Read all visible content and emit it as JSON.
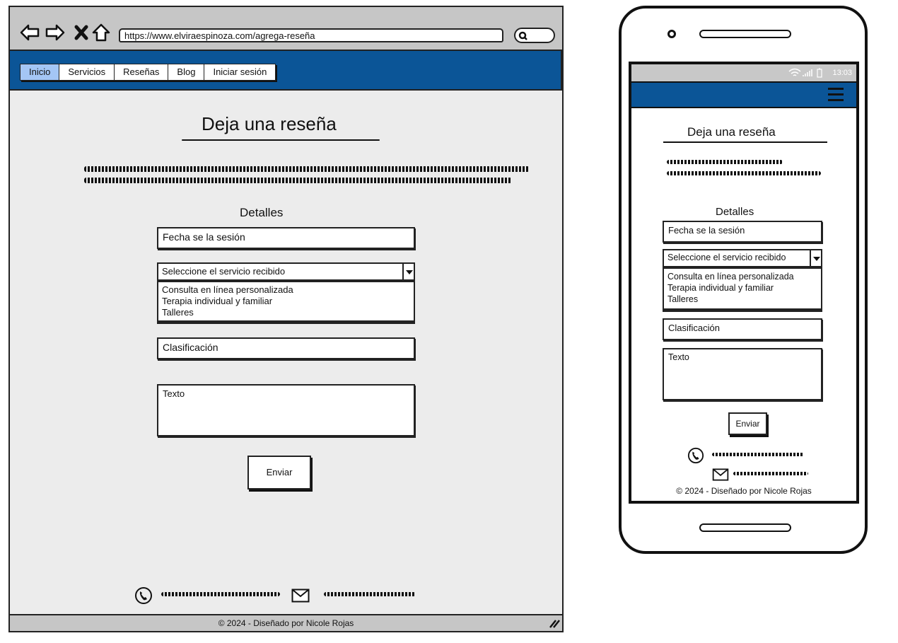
{
  "desktop": {
    "url": "https://www.elviraespinoza.com/agrega-reseña",
    "nav_tabs": [
      "Inicio",
      "Servicios",
      "Reseñas",
      "Blog",
      "Iniciar sesión"
    ],
    "page_title": "Deja una reseña",
    "section_title": "Detalles",
    "form": {
      "date_placeholder": "Fecha se la sesión",
      "service_select": "Seleccione el servicio recibido",
      "service_options": [
        "Consulta en línea personalizada",
        "Terapia individual y familiar",
        "Talleres"
      ],
      "rating_placeholder": "Clasificación",
      "text_placeholder": "Texto",
      "submit_label": "Enviar"
    },
    "footer_copyright": "©  2024 - Diseñado por  Nicole Rojas"
  },
  "mobile": {
    "status_time": "13:03",
    "page_title": "Deja una reseña",
    "section_title": "Detalles",
    "form": {
      "date_placeholder": "Fecha se la sesión",
      "service_select": "Seleccione el servicio recibido",
      "service_options": [
        "Consulta en línea personalizada",
        "Terapia individual y familiar",
        "Talleres"
      ],
      "rating_placeholder": "Clasificación",
      "text_placeholder": "Texto",
      "submit_label": "Enviar"
    },
    "footer_copyright": "©  2024 - Diseñado por Nicole Rojas"
  },
  "icons": {
    "back": "arrow-left-icon",
    "forward": "arrow-right-icon",
    "stop": "close-icon",
    "home": "home-icon",
    "search": "search-icon",
    "phone": "phone-icon",
    "mail": "mail-icon",
    "menu": "hamburger-menu-icon",
    "wifi": "wifi-icon",
    "signal": "signal-icon",
    "battery": "battery-icon"
  },
  "colors": {
    "nav_blue": "#0b5597",
    "active_tab": "#a4c6f5",
    "page_bg": "#ececec",
    "chrome_gray": "#c6c6c6"
  }
}
